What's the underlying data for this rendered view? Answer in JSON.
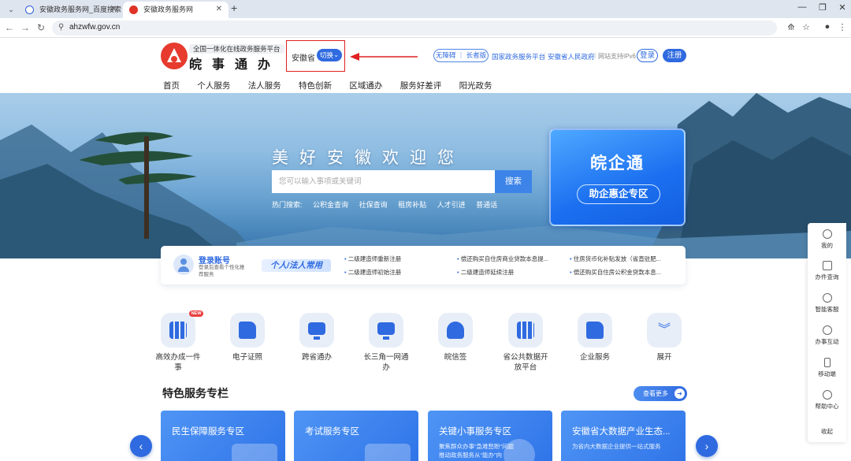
{
  "browser": {
    "tabs": [
      {
        "title": "安徽政务服务网_百度搜索"
      },
      {
        "title": "安徽政务服务网"
      }
    ],
    "url": "ahzwfw.gov.cn"
  },
  "header": {
    "logo_subtitle": "全国一体化在线政务服务平台",
    "logo_name": "皖事通办",
    "region": "安徽省",
    "region_switch": "切换",
    "accessibility": "无障碍 ｜ 长者版",
    "links": [
      "国家政务服务平台",
      "安徽省人民政府"
    ],
    "ipv6": "网站支持IPv6",
    "login": "登录",
    "register": "注册"
  },
  "nav": [
    "首页",
    "个人服务",
    "法人服务",
    "特色创新",
    "区域通办",
    "服务好差评",
    "阳光政务"
  ],
  "hero": {
    "title": "美好安徽欢迎您",
    "search_placeholder": "您可以输入事项或关键词",
    "search_button": "搜索",
    "hot_label": "热门搜索:",
    "hot_items": [
      "公积金查询",
      "社保查询",
      "租房补贴",
      "人才引进",
      "普通话"
    ],
    "promo_title": "皖企通",
    "promo_button": "助企惠企专区"
  },
  "account": {
    "title": "登录账号",
    "desc": "登录后查看个性化推荐服务",
    "badge": "个人/法人常用",
    "links": [
      "二级建造师重新注册",
      "偿还购买自住房商业贷款本息提...",
      "住房货币化补贴发放（省直驻肥...",
      "二级建造师初始注册",
      "二级建造师延续注册",
      "偿还购买自住房公积金贷款本息..."
    ]
  },
  "services": [
    {
      "label": "高效办成一件事",
      "badge": "NEW"
    },
    {
      "label": "电子证照"
    },
    {
      "label": "跨省通办"
    },
    {
      "label": "长三角一网通办"
    },
    {
      "label": "皖信签"
    },
    {
      "label": "省公共数据开放平台"
    },
    {
      "label": "企业服务"
    },
    {
      "label": "展开"
    }
  ],
  "featured": {
    "title": "特色服务专栏",
    "more": "查看更多",
    "cards": [
      {
        "title": "民生保障服务专区",
        "sub": ""
      },
      {
        "title": "考试服务专区",
        "sub": ""
      },
      {
        "title": "关键小事服务专区",
        "sub": "聚焦群众办事“急难愁盼”问题\n推动政务服务从“能办”向"
      },
      {
        "title": "安徽省大数据产业生态...",
        "sub": "为省内大数据企业提供一站式服务"
      }
    ]
  },
  "sidebar": [
    "我的",
    "办件查询",
    "智能客服",
    "办事互动",
    "移动端",
    "帮助中心",
    "收起"
  ],
  "colors": {
    "brand_blue": "#2f6ae0",
    "logo_red": "#e63b2e",
    "highlight_red": "#e02020"
  }
}
